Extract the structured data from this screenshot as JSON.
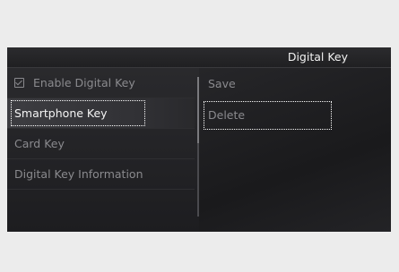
{
  "header": {
    "title": "Digital Key"
  },
  "menu": {
    "items": [
      {
        "label": "Enable Digital Key",
        "checked": true
      },
      {
        "label": "Smartphone Key"
      },
      {
        "label": "Card Key"
      },
      {
        "label": "Digital Key Information"
      }
    ],
    "selected": "Smartphone Key"
  },
  "submenu": {
    "items": [
      {
        "label": "Save"
      },
      {
        "label": "Delete"
      }
    ],
    "focused": "Delete"
  },
  "colors": {
    "screen_bg": "#1c1c1e",
    "text_active": "#f4f4f4",
    "text_dim": "#8a8a8e",
    "focus_outline": "#ffffff"
  }
}
